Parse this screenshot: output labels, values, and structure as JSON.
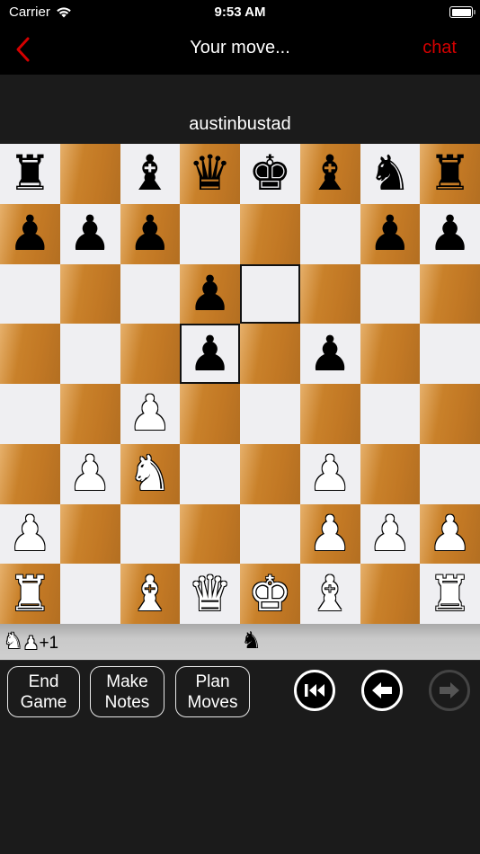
{
  "status_bar": {
    "carrier": "Carrier",
    "time": "9:53 AM",
    "wifi_icon": "wifi-icon",
    "battery_icon": "battery-icon"
  },
  "nav": {
    "back_icon": "chevron-left-icon",
    "title": "Your move...",
    "chat_label": "chat",
    "accent_color": "#d40000"
  },
  "opponent_name": "austinbustad",
  "board": {
    "orientation": "white-bottom",
    "ranks": [
      [
        "r",
        "",
        "b",
        "q",
        "k",
        "b",
        "n",
        "r"
      ],
      [
        "p",
        "p",
        "p",
        "",
        "",
        "",
        "p",
        "p"
      ],
      [
        "",
        "",
        "",
        "p",
        "",
        "",
        "",
        ""
      ],
      [
        "",
        "",
        "",
        "p",
        "",
        "p",
        "",
        ""
      ],
      [
        "",
        "",
        "P",
        "",
        "",
        "",
        "",
        ""
      ],
      [
        "",
        "P",
        "N",
        "",
        "",
        "P",
        "",
        ""
      ],
      [
        "P",
        "",
        "",
        "",
        "",
        "P",
        "P",
        "P"
      ],
      [
        "R",
        "",
        "B",
        "Q",
        "K",
        "B",
        "",
        "R"
      ]
    ],
    "highlighted_squares": [
      "e6",
      "d5"
    ],
    "light_color": "#efeff2",
    "dark_color": "#c27824"
  },
  "captured": {
    "white_side": {
      "pieces": [
        "N",
        "P"
      ],
      "advantage": "+1"
    },
    "black_side": {
      "pieces": [
        "n"
      ]
    }
  },
  "actions": [
    {
      "line1": "End",
      "line2": "Game"
    },
    {
      "line1": "Make",
      "line2": "Notes"
    },
    {
      "line1": "Plan",
      "line2": "Moves"
    }
  ],
  "playback": {
    "first_icon": "skip-to-start-icon",
    "back_icon": "arrow-left-icon",
    "forward_icon": "arrow-right-icon",
    "forward_enabled": false
  }
}
